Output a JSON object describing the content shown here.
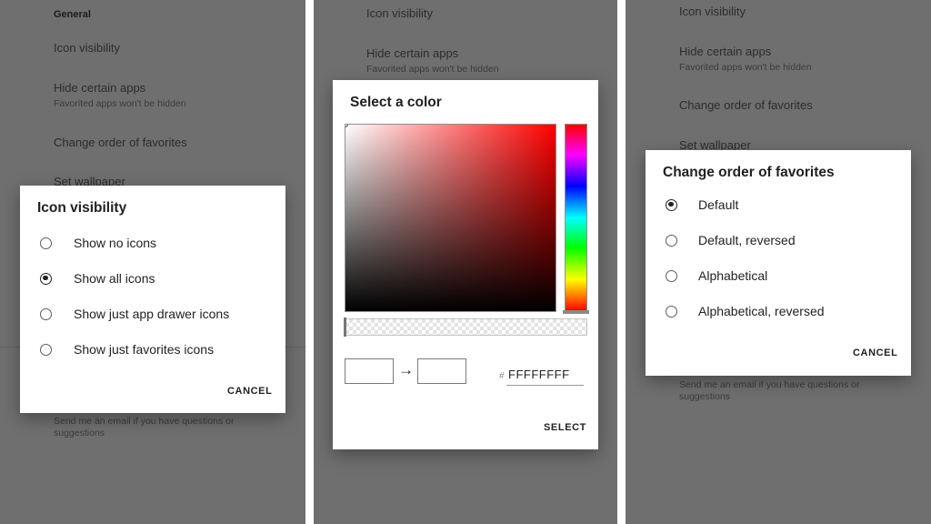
{
  "panel1": {
    "background": {
      "header": "General",
      "icon_visibility": "Icon visibility",
      "hide_apps": "Hide certain apps",
      "hide_apps_sub": "Favorited apps won't be hidden",
      "change_order": "Change order of favorites",
      "set_wallpaper": "Set wallpaper",
      "feedback_line1": "Send me an email if you have questions or",
      "feedback_line2": "suggestions"
    },
    "dialog": {
      "title": "Icon visibility",
      "options": [
        {
          "label": "Show no icons",
          "checked": false
        },
        {
          "label": "Show all icons",
          "checked": true
        },
        {
          "label": "Show just app drawer icons",
          "checked": false
        },
        {
          "label": "Show just favorites icons",
          "checked": false
        }
      ],
      "cancel_label": "CANCEL"
    }
  },
  "panel2": {
    "background": {
      "icon_visibility": "Icon visibility",
      "hide_apps": "Hide certain apps",
      "hide_apps_sub": "Favorited apps won't be hidden"
    },
    "dialog": {
      "title": "Select a color",
      "hex_prefix": "#",
      "hex_value": "FFFFFFFF",
      "select_label": "SELECT",
      "arrow": "→",
      "old_color": "#ffffff",
      "new_color": "#ffffff",
      "hue_color": "#ff0000"
    }
  },
  "panel3": {
    "background": {
      "icon_visibility": "Icon visibility",
      "hide_apps": "Hide certain apps",
      "hide_apps_sub": "Favorited apps won't be hidden",
      "change_order": "Change order of favorites",
      "set_wallpaper": "Set wallpaper",
      "feedback_line1": "Send me an email if you have questions or",
      "feedback_line2": "suggestions"
    },
    "dialog": {
      "title": "Change order of favorites",
      "options": [
        {
          "label": "Default",
          "checked": true
        },
        {
          "label": "Default, reversed",
          "checked": false
        },
        {
          "label": "Alphabetical",
          "checked": false
        },
        {
          "label": "Alphabetical, reversed",
          "checked": false
        }
      ],
      "cancel_label": "CANCEL"
    }
  },
  "colors": {
    "scrim": "#6f6f6f",
    "dialog_bg": "#ffffff",
    "text": "#222222"
  }
}
